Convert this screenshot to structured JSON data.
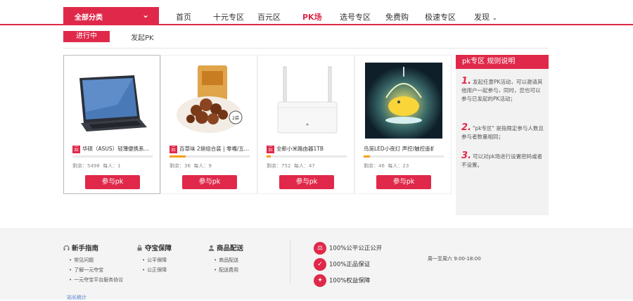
{
  "nav": {
    "all_categories": "全部分类",
    "items": [
      "首页",
      "十元专区",
      "百元区",
      "PK场",
      "选号专区",
      "免费购",
      "极速专区",
      "发现"
    ],
    "active": "PK场"
  },
  "tabs": {
    "active": "进行中",
    "other": "发起PK"
  },
  "products": [
    {
      "name": "华硕（ASUS）轻薄便携系...",
      "progress": 0.0,
      "remaining": "剩余：5498",
      "participants": "每人：1",
      "button": "参与pk"
    },
    {
      "name": "百草味 2袋组合装 | 零嘴/五...",
      "progress": 0.2,
      "remaining": "剩余：36",
      "participants": "每人：9",
      "button": "参与pk"
    },
    {
      "name": "全新小米路由器1TB",
      "progress": 0.05,
      "remaining": "剩余：752",
      "participants": "每人：47",
      "button": "参与pk"
    },
    {
      "name": "鸟笼LED小夜灯 声控/触控遥机发...",
      "progress": 0.08,
      "remaining": "剩余：46",
      "participants": "每人：23",
      "button": "参与pk"
    }
  ],
  "brand_tag": "云",
  "rules": {
    "title": "pk专区 规则说明",
    "items": [
      {
        "num": "1.",
        "text": "发起任意PK活动，可以邀请其他用户一起参与，同时，您也可以参与已发起的PK活动；"
      },
      {
        "num": "2.",
        "text": "\"pk专区\" 是指限定参与人数且参与者数量相同；"
      },
      {
        "num": "3.",
        "text": "可以对pk场进行设置密码或者不设置。"
      }
    ]
  },
  "footer": {
    "columns": [
      {
        "title": "新手指南",
        "links": [
          "常见问题",
          "了解一元夺宝",
          "一元夺宝平台服务协议"
        ]
      },
      {
        "title": "夺宝保障",
        "links": [
          "公平保障",
          "公正保障"
        ]
      },
      {
        "title": "商品配送",
        "links": [
          "商品配送",
          "配送费用"
        ]
      }
    ],
    "guarantees": [
      "100%公平公正公开",
      "100%正品保证",
      "100%权益保障"
    ],
    "hours": "周一至周六 9:00-18:00",
    "stats": "站长统计"
  }
}
